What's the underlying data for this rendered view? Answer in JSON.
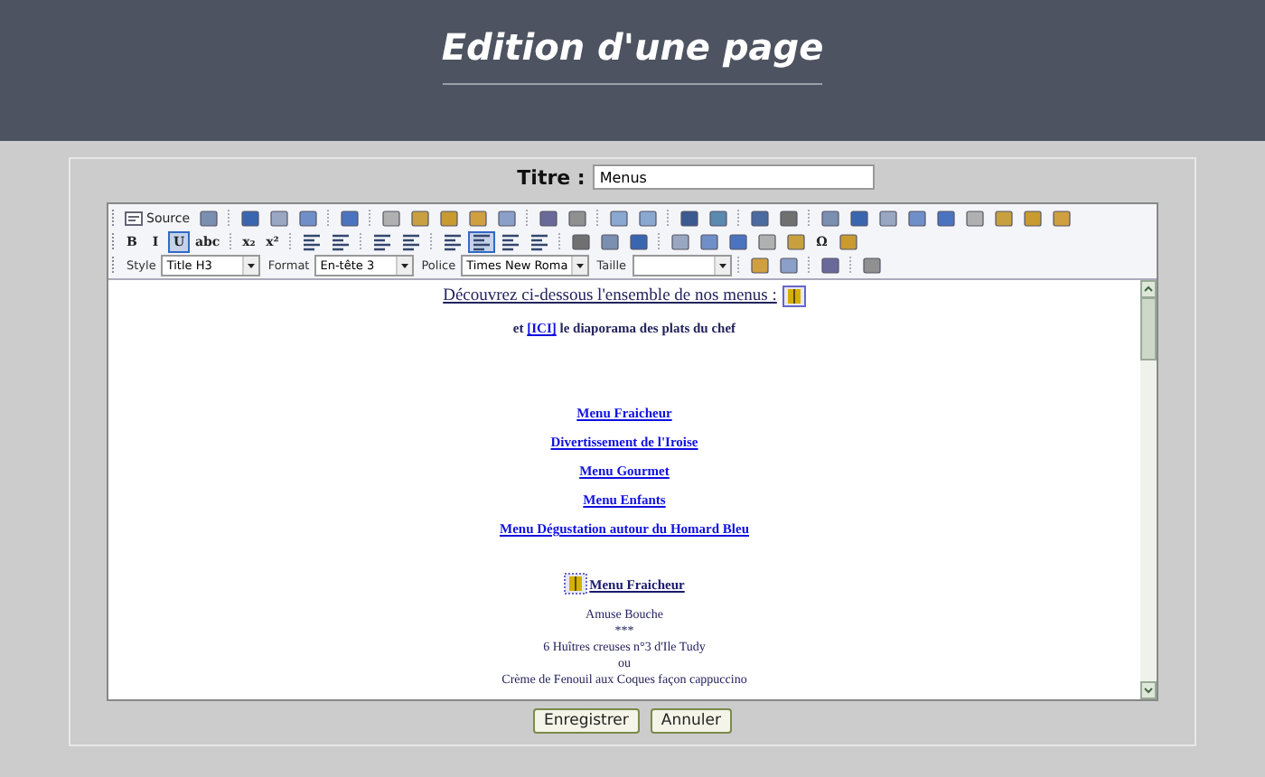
{
  "header": {
    "title": "Edition d'une page"
  },
  "form": {
    "title_label": "Titre :",
    "title_value": "Menus"
  },
  "toolbar": {
    "document_tools": [
      {
        "kind": "source",
        "label": "Source"
      },
      {
        "kind": "icon",
        "selected": false
      },
      {
        "kind": "sep"
      },
      {
        "kind": "icon",
        "selected": false
      },
      {
        "kind": "icon",
        "selected": false
      },
      {
        "kind": "icon",
        "selected": false
      },
      {
        "kind": "sep"
      },
      {
        "kind": "icon",
        "selected": false
      },
      {
        "kind": "sep"
      },
      {
        "kind": "icon",
        "selected": false
      },
      {
        "kind": "icon",
        "selected": false
      },
      {
        "kind": "icon",
        "selected": false
      },
      {
        "kind": "icon",
        "selected": false
      },
      {
        "kind": "icon",
        "selected": false
      },
      {
        "kind": "sep"
      },
      {
        "kind": "icon",
        "selected": false
      },
      {
        "kind": "icon",
        "selected": false
      },
      {
        "kind": "sep"
      },
      {
        "kind": "icon",
        "selected": false
      },
      {
        "kind": "icon",
        "selected": false
      },
      {
        "kind": "sep"
      },
      {
        "kind": "icon",
        "selected": false
      },
      {
        "kind": "icon",
        "selected": false
      },
      {
        "kind": "sep"
      },
      {
        "kind": "icon",
        "selected": false
      },
      {
        "kind": "icon",
        "selected": false
      },
      {
        "kind": "sep"
      },
      {
        "kind": "icon",
        "selected": false
      },
      {
        "kind": "icon",
        "selected": false
      },
      {
        "kind": "icon",
        "selected": false
      },
      {
        "kind": "icon",
        "selected": false
      },
      {
        "kind": "icon",
        "selected": false
      },
      {
        "kind": "icon",
        "selected": false
      },
      {
        "kind": "icon",
        "selected": false
      },
      {
        "kind": "icon",
        "selected": false
      },
      {
        "kind": "icon",
        "selected": false
      }
    ],
    "formatting_tools": [
      {
        "kind": "text",
        "label": "B",
        "selected": false
      },
      {
        "kind": "text",
        "label": "I",
        "selected": false
      },
      {
        "kind": "text",
        "label": "U",
        "selected": true
      },
      {
        "kind": "text",
        "label": "abc",
        "selected": false
      },
      {
        "kind": "sep"
      },
      {
        "kind": "text",
        "label": "x₂",
        "selected": false
      },
      {
        "kind": "text",
        "label": "x²",
        "selected": false
      },
      {
        "kind": "sep"
      },
      {
        "kind": "icon",
        "selected": false
      },
      {
        "kind": "icon",
        "selected": false
      },
      {
        "kind": "sep"
      },
      {
        "kind": "icon",
        "selected": false
      },
      {
        "kind": "icon",
        "selected": false
      },
      {
        "kind": "sep"
      },
      {
        "kind": "icon",
        "selected": false
      },
      {
        "kind": "icon",
        "selected": true
      },
      {
        "kind": "icon",
        "selected": false
      },
      {
        "kind": "icon",
        "selected": false
      },
      {
        "kind": "sep"
      },
      {
        "kind": "icon",
        "selected": false
      },
      {
        "kind": "icon",
        "selected": false
      },
      {
        "kind": "icon",
        "selected": false
      },
      {
        "kind": "sep"
      },
      {
        "kind": "icon",
        "selected": false
      },
      {
        "kind": "icon",
        "selected": false
      },
      {
        "kind": "icon",
        "selected": false
      },
      {
        "kind": "icon",
        "selected": false
      },
      {
        "kind": "icon",
        "selected": false
      },
      {
        "kind": "text",
        "label": "Ω",
        "selected": false
      },
      {
        "kind": "icon",
        "selected": false
      }
    ],
    "style_tools": [
      {
        "kind": "combo",
        "label": "Style",
        "value": "Title H3"
      },
      {
        "kind": "combo",
        "label": "Format",
        "value": "En-tête 3"
      },
      {
        "kind": "combo",
        "label": "Police",
        "value": "Times New Roma"
      },
      {
        "kind": "combo",
        "label": "Taille"
      },
      {
        "kind": "sep"
      },
      {
        "kind": "icon",
        "selected": false
      },
      {
        "kind": "icon",
        "selected": false
      },
      {
        "kind": "sep"
      },
      {
        "kind": "icon",
        "selected": false
      },
      {
        "kind": "sep"
      },
      {
        "kind": "icon",
        "selected": false
      }
    ]
  },
  "content": {
    "intro": "Découvrez ci-dessous l'ensemble de nos menus :",
    "slideshow_prefix": "et",
    "slideshow_link": "[ICI]",
    "slideshow_suffix": "le diaporama des plats du chef",
    "menu_links": [
      "Menu Fraicheur",
      "Divertissement de l'Iroise",
      "Menu Gourmet",
      "Menu Enfants",
      "Menu Dégustation autour du Homard Bleu"
    ],
    "section_title": "Menu Fraicheur",
    "section_lines": [
      "Amuse Bouche",
      "***",
      "6 Huîtres creuses n°3 d'Ile Tudy",
      "ou",
      "Crème de Fenouil aux Coques façon cappuccino"
    ]
  },
  "buttons": [
    "Enregistrer",
    "Annuler"
  ]
}
